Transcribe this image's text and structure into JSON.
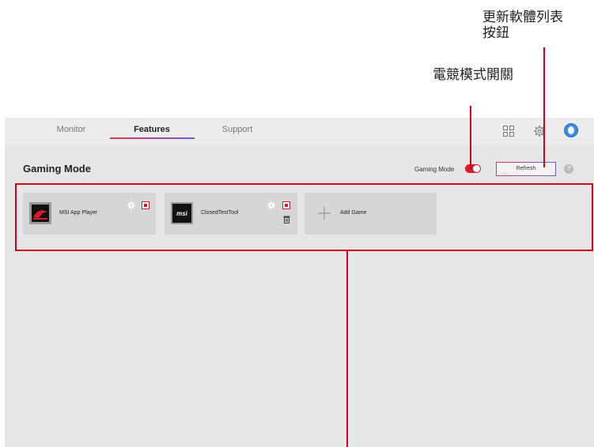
{
  "callouts": {
    "refresh_list_button": "更新軟體列表\n按鈕",
    "gaming_mode_switch": "電競模式開關"
  },
  "nav": {
    "tabs": [
      {
        "label": "Monitor"
      },
      {
        "label": "Features"
      },
      {
        "label": "Support"
      }
    ],
    "active_tab": "Features",
    "icons": [
      "grid-icon",
      "gear-icon",
      "avatar-icon"
    ]
  },
  "section": {
    "title": "Gaming Mode",
    "mode_label": "Gaming Mode",
    "mode_on": true,
    "refresh_label": "Refresh",
    "help_glyph": "?"
  },
  "games": [
    {
      "name": "MSI App Player",
      "icon": "msi-app-player-icon",
      "has_delete": false
    },
    {
      "name": "ClosedTestTool",
      "icon": "msi-logo-icon",
      "has_delete": true
    }
  ],
  "add_game_label": "Add Game",
  "colors": {
    "accent_red": "#d81b2c",
    "accent_purple": "#6f5bd9",
    "callout_red": "#d0021b"
  }
}
